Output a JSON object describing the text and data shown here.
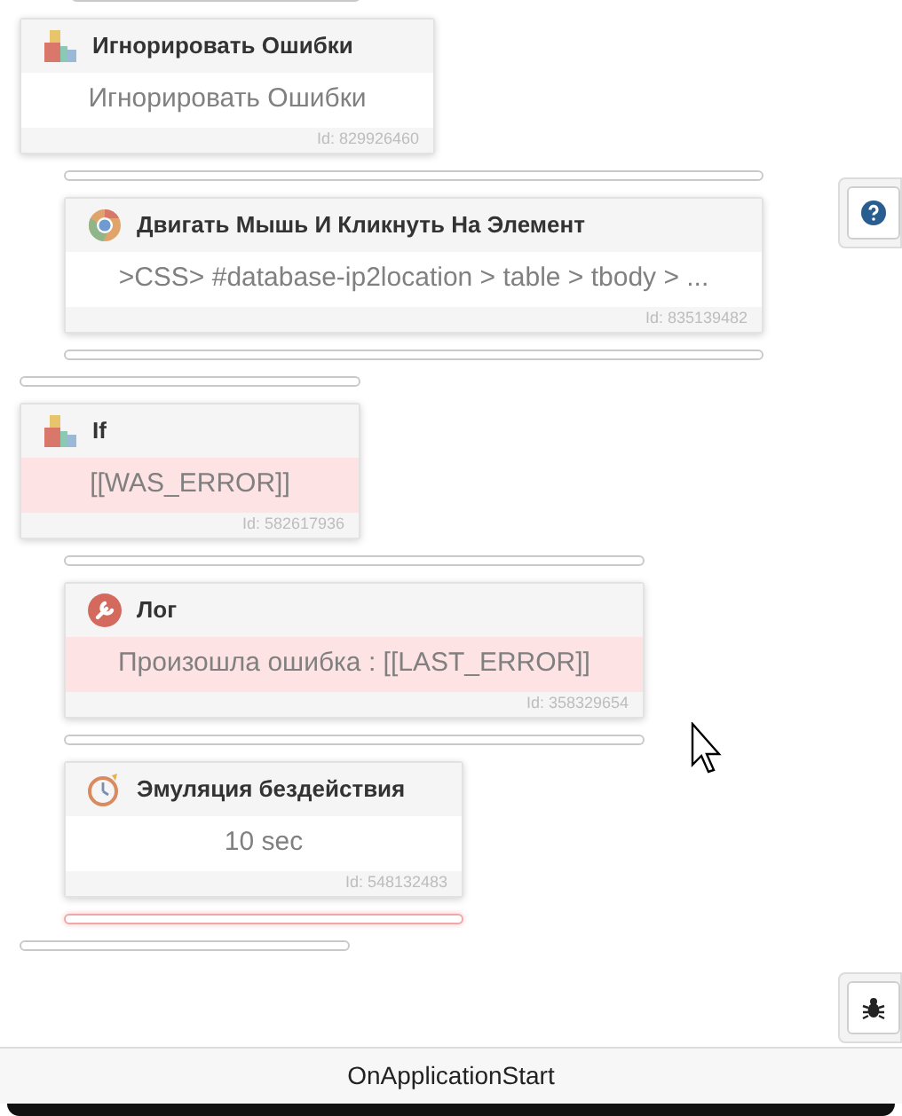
{
  "canvas": {
    "items": [
      {
        "kind": "slot",
        "highlighted": false
      },
      {
        "kind": "group",
        "title": "Игнорировать Ошибки",
        "value": "Игнорировать Ошибки",
        "id": "Id: 829926460",
        "highlighted": false,
        "children": [
          {
            "kind": "slot",
            "highlighted": false
          },
          {
            "kind": "browser",
            "title": "Двигать Мышь И Кликнуть На Элемент",
            "value": ">CSS> #database-ip2location > table > tbody > ...",
            "id": "Id: 835139482",
            "highlighted": false
          },
          {
            "kind": "slot",
            "highlighted": false
          }
        ]
      },
      {
        "kind": "slot",
        "highlighted": false
      },
      {
        "kind": "group",
        "title": "If",
        "value": "[[WAS_ERROR]]",
        "id": "Id: 582617936",
        "highlighted": true,
        "children": [
          {
            "kind": "slot",
            "highlighted": false
          },
          {
            "kind": "log",
            "title": "Лог",
            "value": "Произошла ошибка : [[LAST_ERROR]]",
            "id": "Id: 358329654",
            "highlighted": true
          },
          {
            "kind": "slot",
            "highlighted": false
          },
          {
            "kind": "wait",
            "title": "Эмуляция бездействия",
            "value": "10 sec",
            "id": "Id: 548132483",
            "highlighted": false
          },
          {
            "kind": "slot",
            "highlighted": true
          }
        ]
      },
      {
        "kind": "slot",
        "highlighted": false
      }
    ]
  },
  "side_buttons": [
    {
      "kind": "help"
    },
    {
      "kind": "debug"
    }
  ],
  "footer": {
    "title": "OnApplicationStart"
  }
}
